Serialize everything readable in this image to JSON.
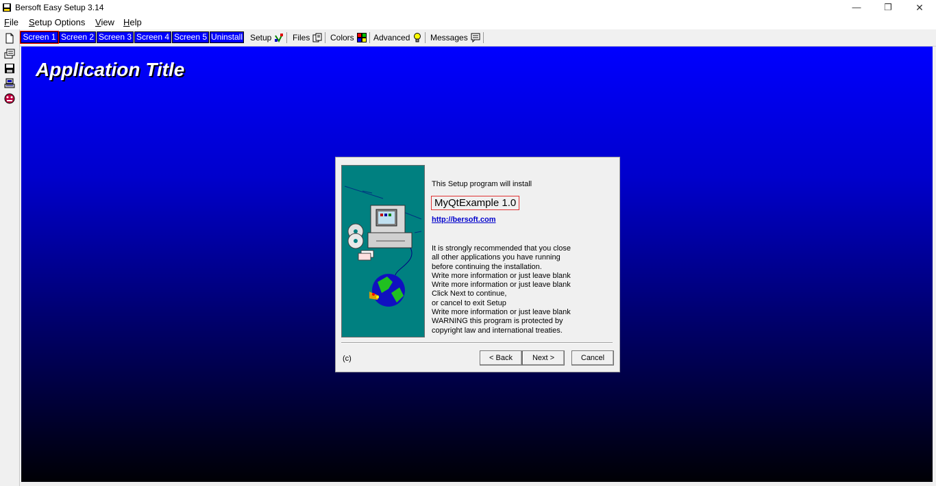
{
  "window": {
    "title": "Bersoft Easy Setup 3.14",
    "controls": {
      "minimize": "—",
      "maximize": "❐",
      "close": "✕"
    }
  },
  "menu": {
    "file": {
      "first": "F",
      "rest": "ile"
    },
    "setup_options": {
      "first": "S",
      "rest": "etup Options"
    },
    "view": {
      "first": "V",
      "rest": "iew"
    },
    "help": {
      "first": "H",
      "rest": "elp"
    }
  },
  "screen_tabs": [
    "Screen 1",
    "Screen 2",
    "Screen 3",
    "Screen 4",
    "Screen 5",
    "Uninstall"
  ],
  "tool_tabs": [
    "Setup",
    "Files",
    "Colors",
    "Advanced",
    "Messages"
  ],
  "left_toolbar": [
    "new-file-icon",
    "open-icon",
    "save-icon",
    "build-icon",
    "run-icon"
  ],
  "canvas": {
    "app_title": "Application Title",
    "gradient_top": "#0000ff",
    "gradient_bottom": "#000005"
  },
  "dialog": {
    "intro": "This Setup program will install",
    "product": "MyQtExample 1.0",
    "link": "http://bersoft.com",
    "lines": [
      "It is strongly recommended that you close",
      "all other applications you have running",
      "before continuing the installation.",
      "Write more information or just leave blank",
      "Write more information or just leave blank",
      "Click Next to continue,",
      "or cancel to exit Setup",
      "Write more information or just leave blank",
      "WARNING this program is protected by",
      "copyright law and international treaties."
    ],
    "copyright": "(c)",
    "back_label": "< Back",
    "next_label": "Next >",
    "cancel_label": "Cancel"
  }
}
